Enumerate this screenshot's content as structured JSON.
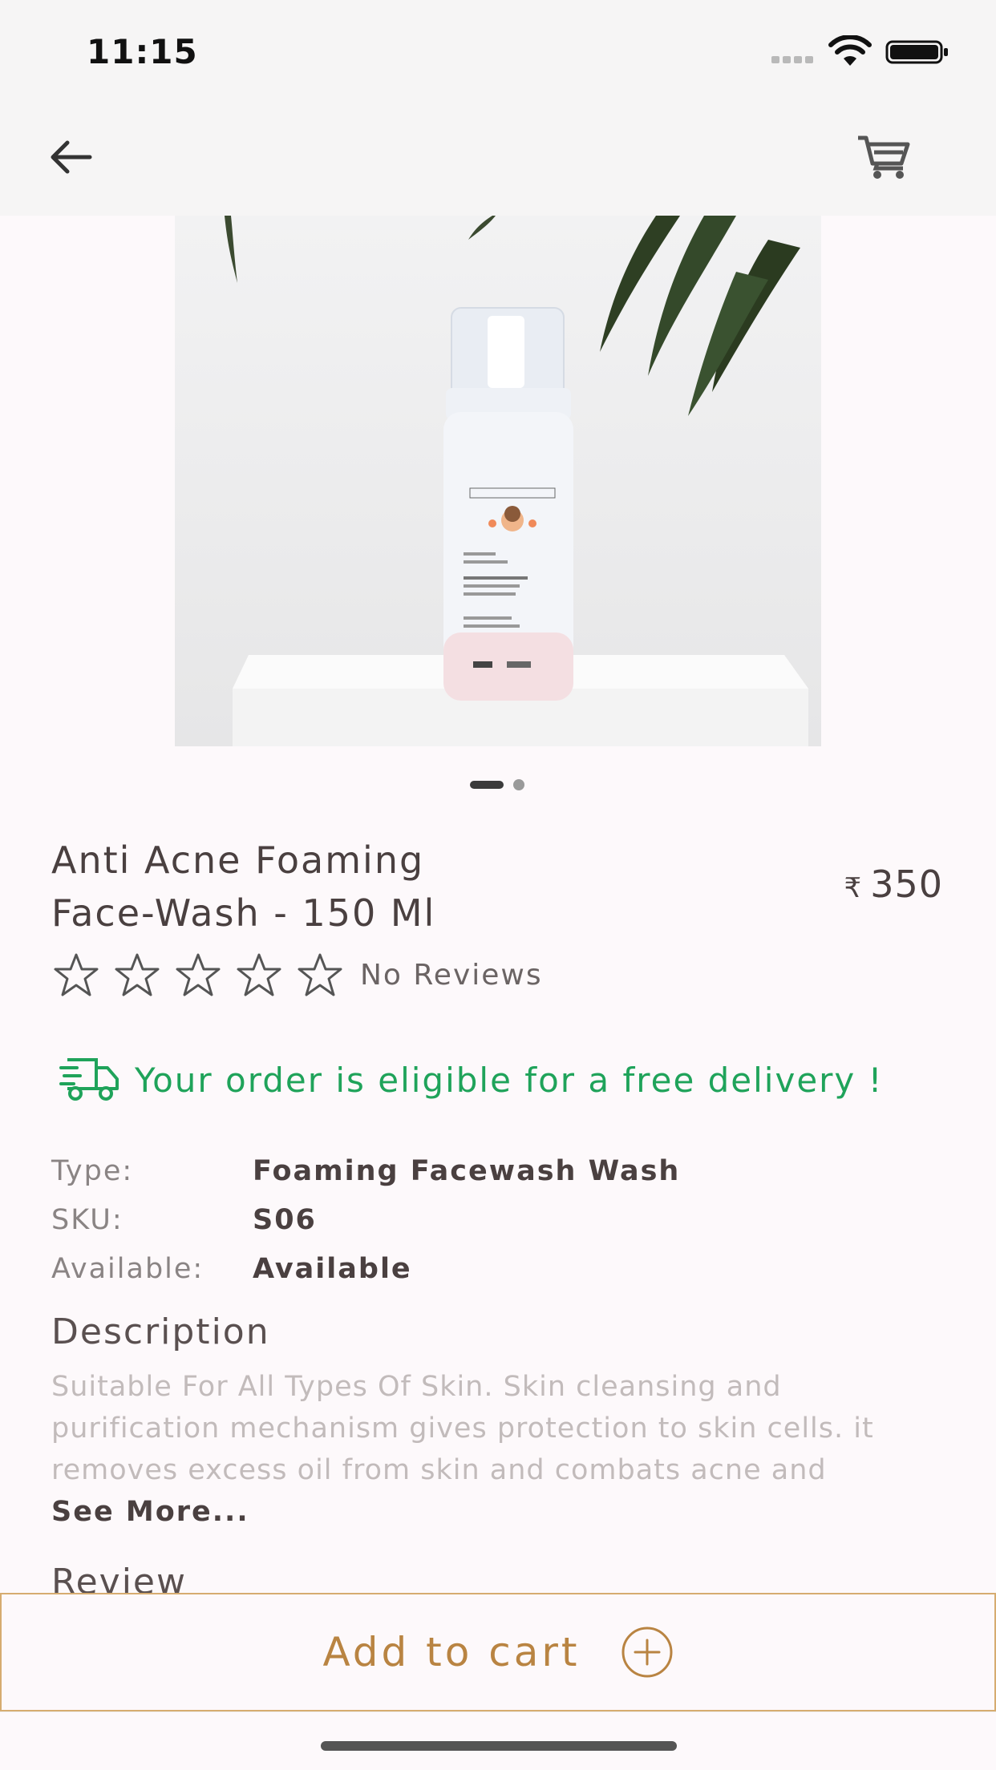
{
  "status_bar": {
    "time": "11:15"
  },
  "nav": {
    "back_icon": "arrow-left-icon",
    "cart_icon": "shopping-cart-icon"
  },
  "gallery": {
    "image_count": 2,
    "active_index": 0
  },
  "product": {
    "title_line1": "Anti Acne Foaming",
    "title_line2": "Face-Wash - 150 Ml",
    "currency_symbol": "₹",
    "price": "350",
    "rating": 0,
    "rating_max": 5,
    "reviews_label": "No Reviews"
  },
  "delivery": {
    "message": "Your order is eligible for a free delivery !",
    "color": "#1fa35a"
  },
  "specs": [
    {
      "key": "Type:",
      "value": "Foaming Facewash Wash"
    },
    {
      "key": "SKU:",
      "value": "S06"
    },
    {
      "key": "Available:",
      "value": "Available"
    }
  ],
  "description": {
    "heading": "Description",
    "text": "Suitable For All Types Of Skin. Skin cleansing and purification mechanism gives protection to skin cells. it removes excess oil from skin and combats acne and",
    "see_more": "See More..."
  },
  "review": {
    "heading": "Review"
  },
  "cart_button": {
    "label": "Add to cart",
    "accent": "#b98442"
  }
}
